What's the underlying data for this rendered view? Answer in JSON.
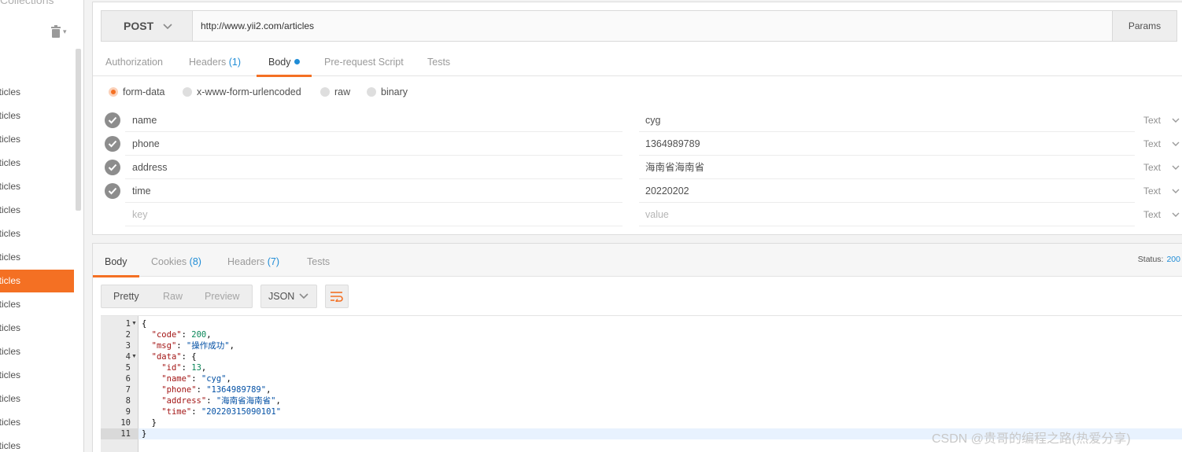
{
  "sidebar": {
    "collections_label": "Collections",
    "items": [
      {
        "label": "articles"
      },
      {
        "label": "articles"
      },
      {
        "label": "articles"
      },
      {
        "label": "articles"
      },
      {
        "label": "articles"
      },
      {
        "label": "articles"
      },
      {
        "label": "articles"
      },
      {
        "label": "articles"
      },
      {
        "label": "articles",
        "active": true
      },
      {
        "label": "articles"
      },
      {
        "label": "articles"
      },
      {
        "label": "articles"
      },
      {
        "label": "articles"
      },
      {
        "label": "articles"
      },
      {
        "label": "articles"
      },
      {
        "label": "articles"
      }
    ],
    "trash_icon": "trash-icon"
  },
  "request": {
    "method": "POST",
    "url": "http://www.yii2.com/articles",
    "params_label": "Params",
    "tabs": [
      {
        "label": "Authorization"
      },
      {
        "label": "Headers",
        "count": "(1)"
      },
      {
        "label": "Body",
        "active": true
      },
      {
        "label": "Pre-request Script"
      },
      {
        "label": "Tests"
      }
    ],
    "body_types": [
      {
        "label": "form-data",
        "selected": true
      },
      {
        "label": "x-www-form-urlencoded"
      },
      {
        "label": "raw"
      },
      {
        "label": "binary"
      }
    ],
    "form_rows": [
      {
        "key": "name",
        "value": "cyg",
        "type": "Text"
      },
      {
        "key": "phone",
        "value": "1364989789",
        "type": "Text"
      },
      {
        "key": "address",
        "value": "海南省海南省",
        "type": "Text"
      },
      {
        "key": "time",
        "value": "20220202",
        "type": "Text"
      }
    ],
    "new_row": {
      "key_placeholder": "key",
      "value_placeholder": "value",
      "type": "Text"
    }
  },
  "response": {
    "tabs": [
      {
        "label": "Body",
        "active": true
      },
      {
        "label": "Cookies",
        "count": "(8)"
      },
      {
        "label": "Headers",
        "count": "(7)"
      },
      {
        "label": "Tests"
      }
    ],
    "status_label": "Status:",
    "status_code": "200",
    "view_modes": [
      "Pretty",
      "Raw",
      "Preview"
    ],
    "format": "JSON",
    "line_numbers": [
      "1",
      "2",
      "3",
      "4",
      "5",
      "6",
      "7",
      "8",
      "9",
      "10",
      "11"
    ],
    "code_lines": [
      "{",
      "  \"code\": 200,",
      "  \"msg\": \"操作成功\",",
      "  \"data\": {",
      "    \"id\": 13,",
      "    \"name\": \"cyg\",",
      "    \"phone\": \"1364989789\",",
      "    \"address\": \"海南省海南省\",",
      "    \"time\": \"20220315090101\"",
      "  }",
      "}"
    ]
  },
  "watermark": "CSDN @贵哥的编程之路(热爱分享)",
  "colors": {
    "accent": "#f47023",
    "link": "#1f8cd6"
  }
}
